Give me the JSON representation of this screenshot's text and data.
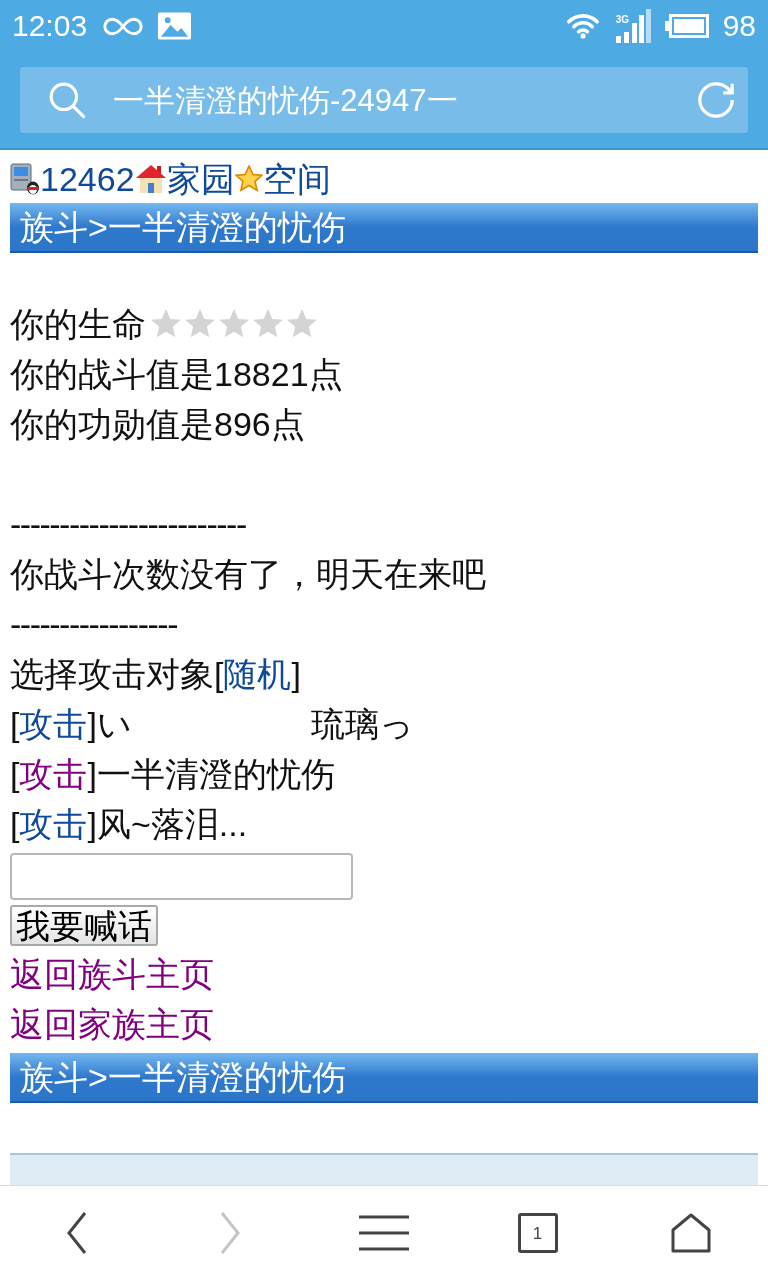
{
  "status_bar": {
    "time": "12:03",
    "network_type": "3G",
    "battery": "98"
  },
  "address_bar": {
    "title": "一半清澄的忧伤-24947一"
  },
  "top_links": [
    {
      "label": "12462",
      "visited": false
    },
    {
      "label": "家园",
      "visited": false
    },
    {
      "label": "空间",
      "visited": false
    }
  ],
  "header": {
    "title": "族斗>一半清澄的忧伤"
  },
  "life": {
    "label": "你的生命",
    "stars": 0
  },
  "stats": [
    "你的战斗值是18821点",
    "你的功勋值是896点"
  ],
  "divider_1": "------------------------",
  "notice": "你战斗次数没有了，明天在来吧",
  "divider_2": "-----------------",
  "target_select": {
    "label": "选择攻击对象",
    "open": "[",
    "link": "随机",
    "close": "]",
    "visited": false
  },
  "attack_targets": [
    {
      "open": "[",
      "link": "攻击",
      "close": "]",
      "name": "い　　　　　 琉璃っ",
      "visited": false
    },
    {
      "open": "[",
      "link": "攻击",
      "close": "]",
      "name": "一半清澄的忧伤",
      "visited": true
    },
    {
      "open": "[",
      "link": "攻击",
      "close": "]",
      "name": "风~落泪...",
      "visited": false
    }
  ],
  "shout_form": {
    "button": "我要喊话"
  },
  "back_links": [
    {
      "label": "返回族斗主页",
      "visited": true
    },
    {
      "label": "返回家族主页",
      "visited": true
    }
  ],
  "footer_header": {
    "title": "族斗>一半清澄的忧伤"
  },
  "browser_nav": [
    {
      "kind": "back",
      "disabled": false
    },
    {
      "kind": "forward",
      "disabled": true
    },
    {
      "kind": "menu"
    },
    {
      "kind": "tabs",
      "count": "1"
    },
    {
      "kind": "home"
    }
  ]
}
